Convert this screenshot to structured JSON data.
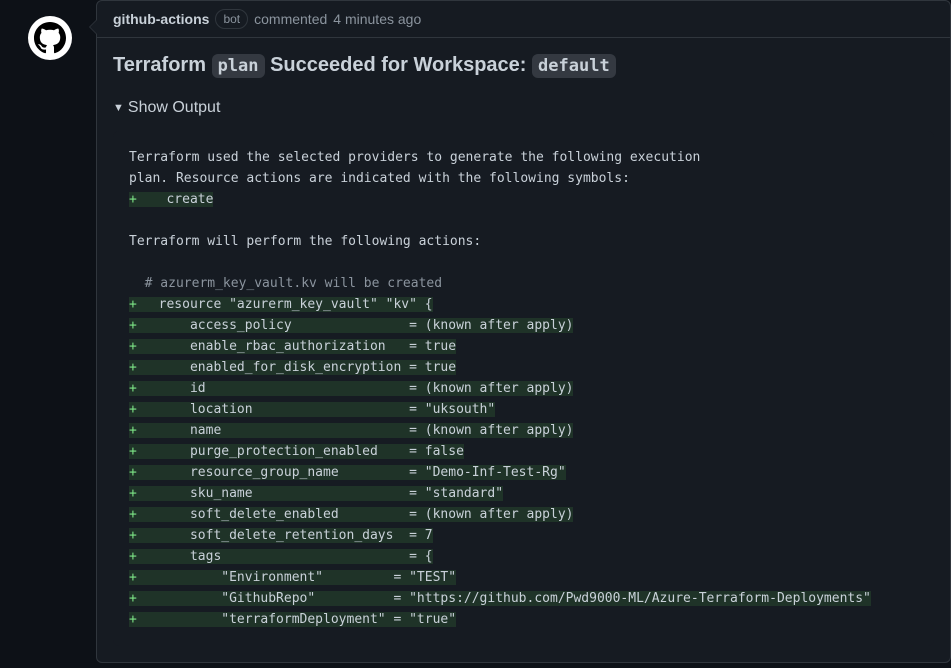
{
  "header": {
    "author": "github-actions",
    "badge": "bot",
    "action_text": "commented",
    "timestamp": "4 minutes ago"
  },
  "title": {
    "prefix": "Terraform",
    "code1": "plan",
    "middle": "Succeeded for Workspace:",
    "code2": "default"
  },
  "details": {
    "summary": "Show Output"
  },
  "output": {
    "intro_line1": "Terraform used the selected providers to generate the following execution",
    "intro_line2": "plan. Resource actions are indicated with the following symbols:",
    "legend_symbol": "+",
    "legend_text": "create",
    "will_perform": "Terraform will perform the following actions:",
    "resource_comment": "# azurerm_key_vault.kv will be created",
    "rows": [
      "  resource \"azurerm_key_vault\" \"kv\" {",
      "      access_policy               = (known after apply)",
      "      enable_rbac_authorization   = true",
      "      enabled_for_disk_encryption = true",
      "      id                          = (known after apply)",
      "      location                    = \"uksouth\"",
      "      name                        = (known after apply)",
      "      purge_protection_enabled    = false",
      "      resource_group_name         = \"Demo-Inf-Test-Rg\"",
      "      sku_name                    = \"standard\"",
      "      soft_delete_enabled         = (known after apply)",
      "      soft_delete_retention_days  = 7",
      "      tags                        = {",
      "          \"Environment\"         = \"TEST\"",
      "          \"GithubRepo\"          = \"https://github.com/Pwd9000-ML/Azure-Terraform-Deployments\"",
      "          \"terraformDeployment\" = \"true\""
    ]
  }
}
